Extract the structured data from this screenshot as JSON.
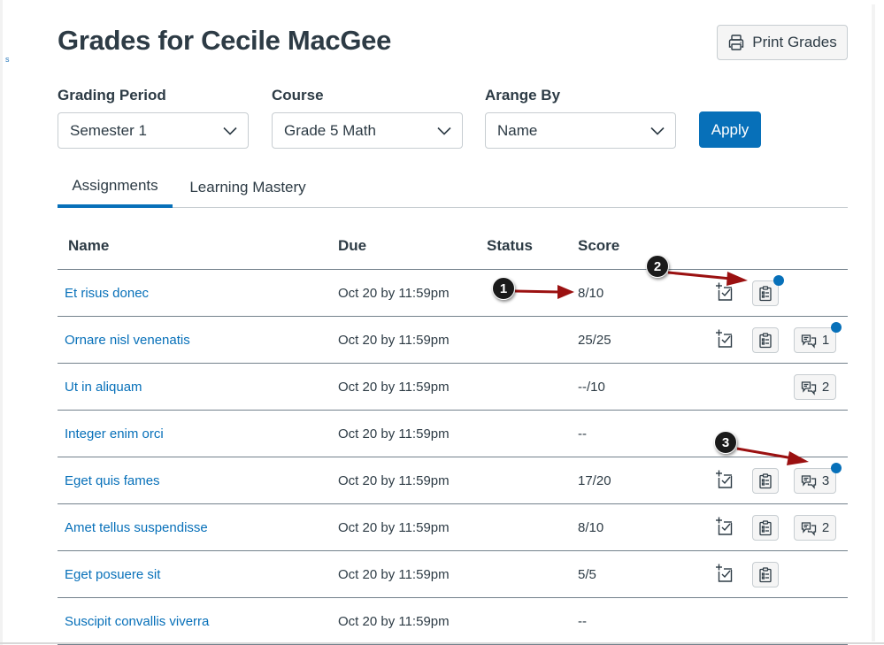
{
  "page": {
    "title": "Grades for Cecile MacGee",
    "left_edge_glyph": "s"
  },
  "toolbar": {
    "print_label": "Print Grades",
    "apply_label": "Apply"
  },
  "filters": {
    "grading_period": {
      "label": "Grading Period",
      "value": "Semester 1"
    },
    "course": {
      "label": "Course",
      "value": "Grade 5 Math"
    },
    "arrange_by": {
      "label": "Arange By",
      "value": "Name"
    }
  },
  "tabs": [
    {
      "label": "Assignments",
      "active": true
    },
    {
      "label": "Learning Mastery",
      "active": false
    }
  ],
  "table": {
    "headers": {
      "name": "Name",
      "due": "Due",
      "status": "Status",
      "score": "Score"
    },
    "rows": [
      {
        "name": "Et risus donec",
        "due": "Oct 20 by 11:59pm",
        "status": "",
        "score": "8/10",
        "what_if": true,
        "rubric": true,
        "rubric_unread": true,
        "comments": null,
        "comments_unread": false
      },
      {
        "name": "Ornare nisl venenatis",
        "due": "Oct 20 by 11:59pm",
        "status": "",
        "score": "25/25",
        "what_if": true,
        "rubric": true,
        "rubric_unread": false,
        "comments": "1",
        "comments_unread": true
      },
      {
        "name": "Ut in aliquam",
        "due": "Oct 20 by 11:59pm",
        "status": "",
        "score": "--/10",
        "what_if": false,
        "rubric": false,
        "rubric_unread": false,
        "comments": "2",
        "comments_unread": false
      },
      {
        "name": "Integer enim orci",
        "due": "Oct 20 by 11:59pm",
        "status": "",
        "score": "--",
        "what_if": false,
        "rubric": false,
        "rubric_unread": false,
        "comments": null,
        "comments_unread": false
      },
      {
        "name": "Eget quis fames",
        "due": "Oct 20 by 11:59pm",
        "status": "",
        "score": "17/20",
        "what_if": true,
        "rubric": true,
        "rubric_unread": false,
        "comments": "3",
        "comments_unread": true
      },
      {
        "name": "Amet tellus suspendisse",
        "due": "Oct 20 by 11:59pm",
        "status": "",
        "score": "8/10",
        "what_if": true,
        "rubric": true,
        "rubric_unread": false,
        "comments": "2",
        "comments_unread": false
      },
      {
        "name": "Eget posuere sit",
        "due": "Oct 20 by 11:59pm",
        "status": "",
        "score": "5/5",
        "what_if": true,
        "rubric": true,
        "rubric_unread": false,
        "comments": null,
        "comments_unread": false
      },
      {
        "name": "Suscipit convallis viverra",
        "due": "Oct 20 by 11:59pm",
        "status": "",
        "score": "--",
        "what_if": false,
        "rubric": false,
        "rubric_unread": false,
        "comments": null,
        "comments_unread": false
      }
    ]
  },
  "callouts": [
    {
      "number": "1",
      "target": "score"
    },
    {
      "number": "2",
      "target": "rubric"
    },
    {
      "number": "3",
      "target": "comments"
    }
  ],
  "colors": {
    "accent": "#0770b9",
    "text": "#2d3b45",
    "callout_arrow": "#9b1111"
  },
  "icons": {
    "print": "printer-icon",
    "chevron": "chevron-down-icon",
    "what_if": "what-if-score-icon",
    "rubric": "rubric-clipboard-icon",
    "comments": "comments-icon"
  }
}
